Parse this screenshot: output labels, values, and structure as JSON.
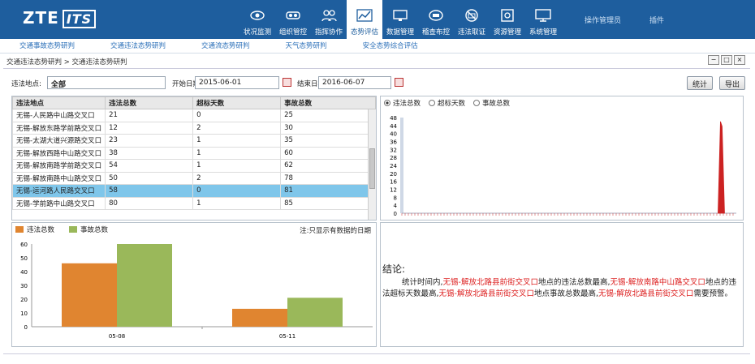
{
  "header": {
    "logo_text": "ZTE",
    "logo_mark": "ITS",
    "nav": [
      {
        "label": "状况监测",
        "icon": "eye-icon"
      },
      {
        "label": "组织管控",
        "icon": "vr-goggles-icon"
      },
      {
        "label": "指挥协作",
        "icon": "people-icon"
      },
      {
        "label": "态势评估",
        "icon": "trend-chart-icon",
        "active": true
      },
      {
        "label": "数据管理",
        "icon": "monitor-icon"
      },
      {
        "label": "稽查布控",
        "icon": "badge-icon"
      },
      {
        "label": "违法取证",
        "icon": "no-camera-icon"
      },
      {
        "label": "资源管理",
        "icon": "safe-icon"
      },
      {
        "label": "系统管理",
        "icon": "display-icon"
      }
    ],
    "user": "操作管理员",
    "plugin": "插件"
  },
  "subnav": [
    "交通事故态势研判",
    "交通违法态势研判",
    "交通流态势研判",
    "天气态势研判",
    "安全态势综合评估"
  ],
  "breadcrumb": "交通违法态势研判 > 交通违法态势研判",
  "window_buttons": [
    "−",
    "□",
    "×"
  ],
  "filter": {
    "location_label": "违法地点:",
    "location_value": "全部",
    "start_label": "开始日期:",
    "start_value": "2015-06-01",
    "end_label": "结束日期:",
    "end_value": "2016-06-07",
    "stat_button": "统计",
    "export_button": "导出"
  },
  "table": {
    "headers": [
      "违法地点",
      "违法总数",
      "超标天数",
      "事故总数"
    ],
    "rows": [
      [
        "无锡-人民路中山路交叉口",
        "21",
        "0",
        "25"
      ],
      [
        "无锡-解放东路学前路交叉口",
        "12",
        "2",
        "30"
      ],
      [
        "无锡-太湖大道兴源路交叉口",
        "23",
        "1",
        "35"
      ],
      [
        "无锡-解放西路中山路交叉口",
        "38",
        "1",
        "60"
      ],
      [
        "无锡-解放南路学前路交叉口",
        "54",
        "1",
        "62"
      ],
      [
        "无锡-解放南路中山路交叉口",
        "50",
        "2",
        "78"
      ],
      [
        "无锡-运河路人民路交叉口",
        "58",
        "0",
        "81"
      ],
      [
        "无锡-学前路中山路交叉口",
        "80",
        "1",
        "85"
      ]
    ],
    "selected_row": 6
  },
  "line_chart_options": {
    "radios": [
      {
        "label": "违法总数",
        "checked": true
      },
      {
        "label": "超标天数",
        "checked": false
      },
      {
        "label": "事故总数",
        "checked": false
      }
    ]
  },
  "bar_chart": {
    "note": "注:只显示有数据的日期"
  },
  "conclusion": {
    "heading": "结论:",
    "p1": "统计时间内,",
    "loc1": "无锡-解放北路县前街交叉口",
    "p2": "地点的违法总数最高,",
    "loc2": "无锡-解放南路中山路交叉口",
    "p3": "地点的违法超标天数最高,",
    "loc3": "无锡-解放北路县前街交叉口",
    "p4": "地点事故总数最高,",
    "loc4": "无锡-解放北路县前街交叉口",
    "p5": "需要预警。"
  },
  "chart_data": [
    {
      "type": "line",
      "title": "",
      "ylim": [
        0,
        48
      ],
      "yticks": [
        "48",
        "44",
        "40",
        "36",
        "32",
        "28",
        "24",
        "20",
        "16",
        "12",
        "8",
        "4",
        "0"
      ],
      "series": [
        {
          "color": "#cc2222",
          "spike_position": 0.955,
          "spike_value": 46
        }
      ]
    },
    {
      "type": "bar",
      "categories": [
        "05-08",
        "05-11"
      ],
      "series": [
        {
          "name": "违法总数",
          "color": "#e08530",
          "values": [
            46,
            13
          ]
        },
        {
          "name": "事故总数",
          "color": "#9ab85a",
          "values": [
            60,
            21
          ]
        }
      ],
      "ylim": [
        0,
        60
      ],
      "yticks": [
        "60",
        "50",
        "40",
        "30",
        "20",
        "10",
        "0"
      ]
    }
  ]
}
